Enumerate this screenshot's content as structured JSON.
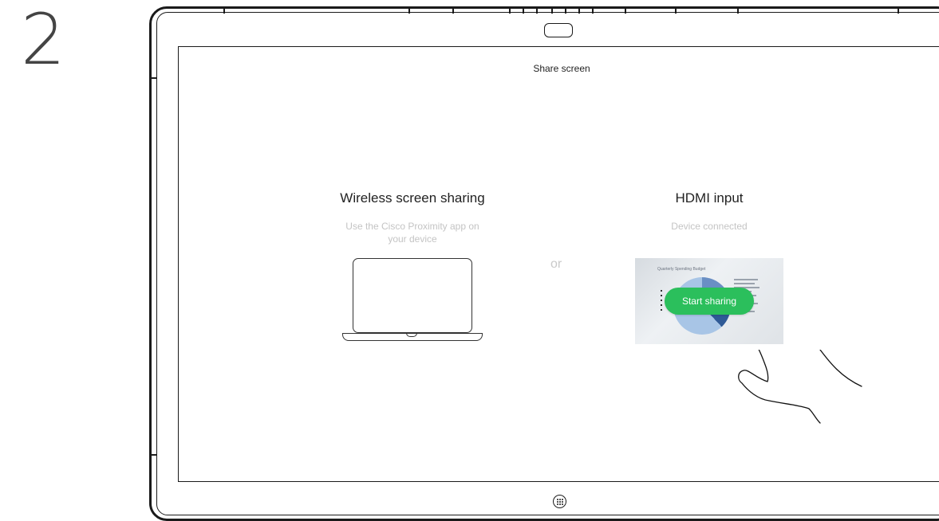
{
  "step": {
    "number": "2"
  },
  "screen": {
    "title": "Share screen"
  },
  "wireless": {
    "title": "Wireless screen sharing",
    "subtitle_line1": "Use the Cisco Proximity app on",
    "subtitle_line2": "your device"
  },
  "divider": {
    "label": "or"
  },
  "hdmi": {
    "title": "HDMI input",
    "subtitle": "Device connected",
    "preview_caption": "Quarterly Spending Budget",
    "button_label": "Start sharing"
  },
  "colors": {
    "accent_green": "#2bbf5c",
    "muted_text": "#c4c4c4",
    "outline": "#1a1a1a"
  },
  "icons": {
    "camera": "camera-icon",
    "home": "home-grid-icon",
    "laptop": "laptop-icon",
    "hand": "hand-pointer-icon"
  }
}
